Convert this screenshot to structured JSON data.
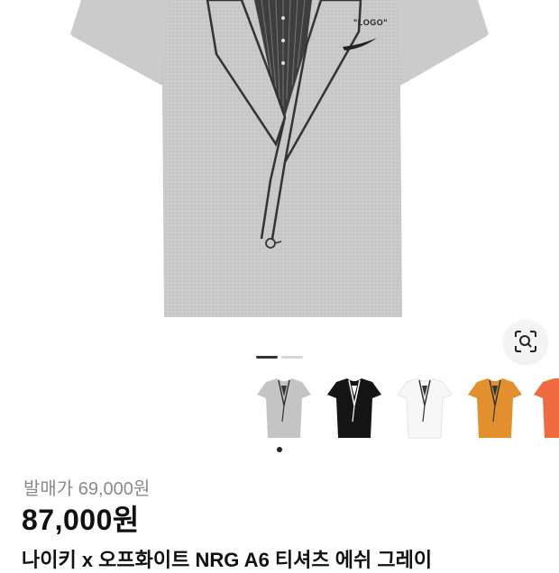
{
  "product": {
    "image_alt": "Gray tuxedo print t-shirt",
    "graphic_text": "\"LOGO\"",
    "thumbnails": [
      {
        "name": "gray",
        "color": "#c4c4c4"
      },
      {
        "name": "black",
        "color": "#151515"
      },
      {
        "name": "white",
        "color": "#f7f7f7"
      },
      {
        "name": "orange",
        "color": "#e2902e"
      },
      {
        "name": "red-orange",
        "color": "#f06a3f"
      }
    ],
    "gallery_position": {
      "current": 1,
      "total": 2
    },
    "selected_thumbnail": 1,
    "original_price": "발매가 69,000원",
    "price": "87,000원",
    "title": "나이키 x 오프화이트 NRG A6 티셔츠 에쉬 그레이"
  },
  "icons": {
    "lens": "image-search-icon"
  }
}
